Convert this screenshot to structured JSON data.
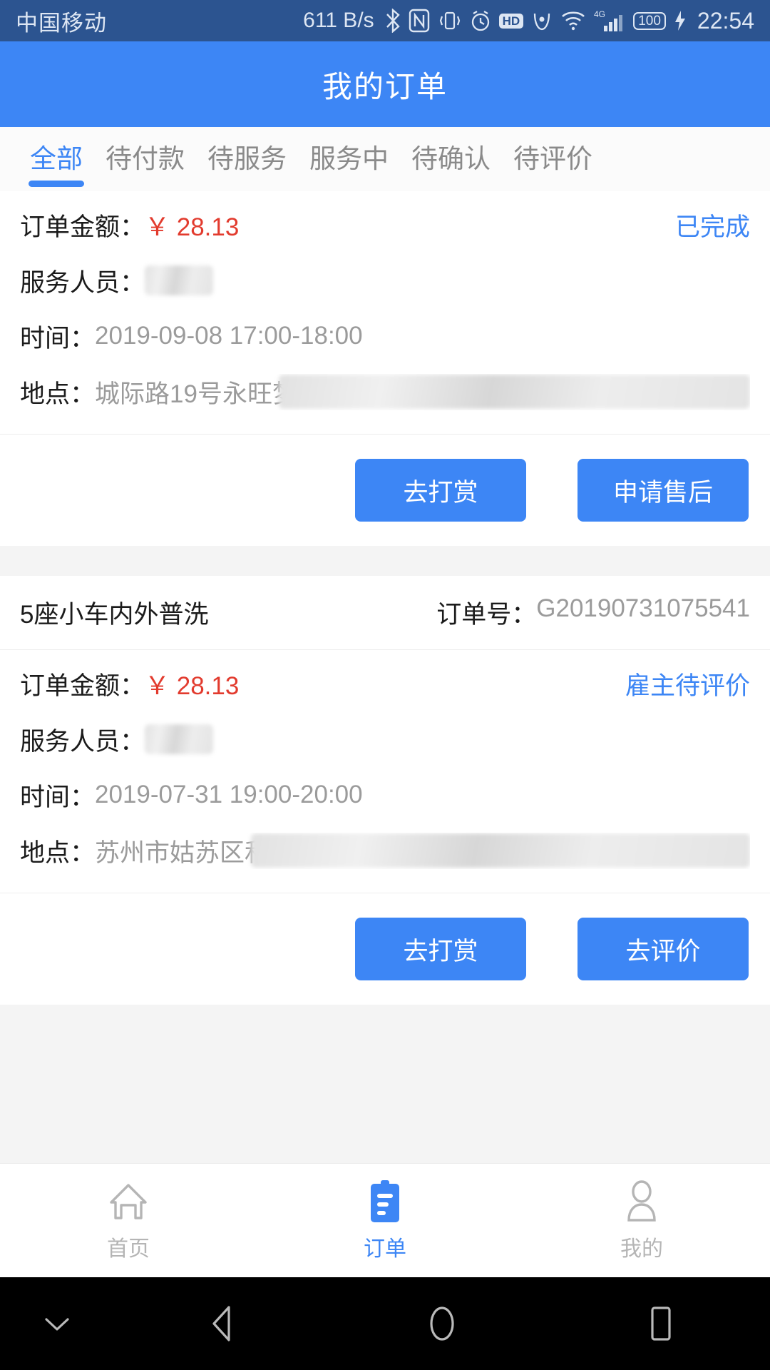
{
  "statusbar": {
    "carrier": "中国移动",
    "net_speed": "611 B/s",
    "icons": [
      "bluetooth-icon",
      "nfc-icon",
      "vibrate-icon",
      "alarm-icon",
      "hd-icon",
      "eye-care-icon",
      "wifi-icon",
      "signal-4g-icon",
      "battery-icon"
    ],
    "hd_label": "HD",
    "network_type": "4G",
    "battery_level": "100",
    "time": "22:54"
  },
  "header": {
    "title": "我的订单"
  },
  "tabs": {
    "items": [
      {
        "label": "全部",
        "active": true
      },
      {
        "label": "待付款",
        "active": false
      },
      {
        "label": "待服务",
        "active": false
      },
      {
        "label": "服务中",
        "active": false
      },
      {
        "label": "待确认",
        "active": false
      },
      {
        "label": "待评价",
        "active": false
      }
    ]
  },
  "labels": {
    "amount": "订单金额：",
    "staff": "服务人员：",
    "time": "时间：",
    "location": "地点：",
    "order_no": "订单号："
  },
  "orders": [
    {
      "amount": "￥ 28.13",
      "status": "已完成",
      "staff_redacted": true,
      "time": "2019-09-08 17:00-18:00",
      "location": "城际路19号永旺梦",
      "location_redacted": true,
      "buttons": [
        {
          "label": "去打赏",
          "name": "tip-button"
        },
        {
          "label": "申请售后",
          "name": "after-sales-button"
        }
      ]
    },
    {
      "title": "5座小车内外普洗",
      "order_no": "G20190731075541",
      "amount": "￥ 28.13",
      "status": "雇主待评价",
      "staff_redacted": true,
      "time": "2019-07-31 19:00-20:00",
      "location": "苏州市姑苏区和",
      "location_redacted": true,
      "buttons": [
        {
          "label": "去打赏",
          "name": "tip-button"
        },
        {
          "label": "去评价",
          "name": "review-button"
        }
      ]
    }
  ],
  "bottom_nav": {
    "items": [
      {
        "label": "首页",
        "icon": "home-icon",
        "active": false
      },
      {
        "label": "订单",
        "icon": "clipboard-icon",
        "active": true
      },
      {
        "label": "我的",
        "icon": "person-icon",
        "active": false
      }
    ]
  },
  "android_nav": {
    "buttons": [
      "hide-navbar-icon",
      "back-icon",
      "home-icon",
      "recents-icon"
    ]
  },
  "colors": {
    "accent": "#3d86f5",
    "statusbar_bg": "#2c5490",
    "price_red": "#e23b2e",
    "muted_text": "#9b9b9b"
  }
}
